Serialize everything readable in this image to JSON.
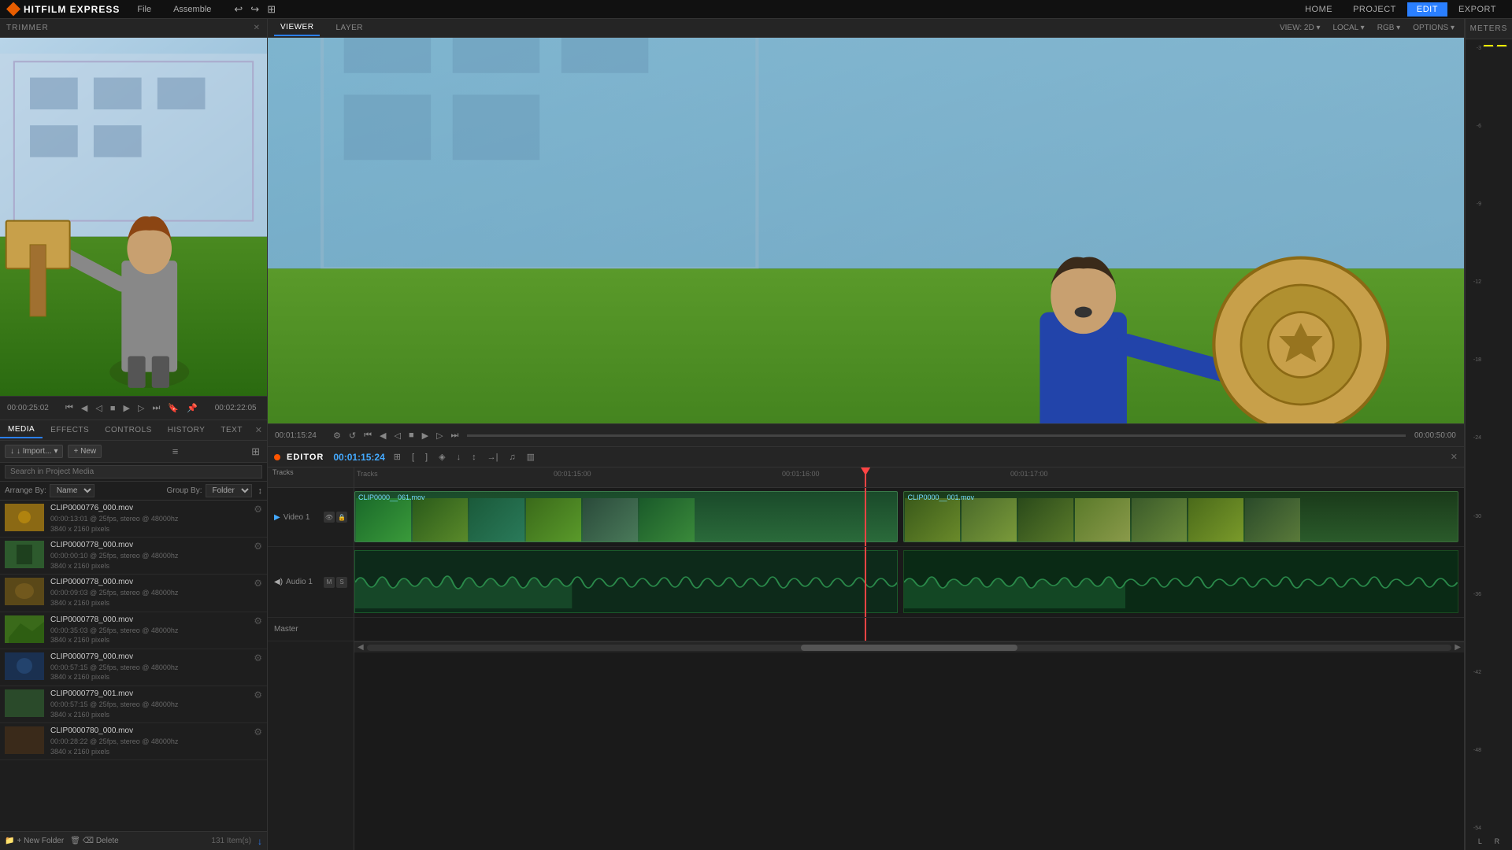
{
  "app": {
    "logo": "HITFILM EXPRESS",
    "nav": {
      "menus": [
        "File",
        "Assemble"
      ],
      "tabs": [
        "HOME",
        "PROJECT",
        "EDIT",
        "EXPORT"
      ],
      "active_tab": "EDIT"
    }
  },
  "trimmer": {
    "label": "TRIMMER",
    "time_start": "00:00:25:02",
    "time_end": "00:02:22:05",
    "controls": [
      "⏮",
      "◀◀",
      "◀",
      "▶",
      "▶▶",
      "⏭"
    ]
  },
  "panels": {
    "tabs": [
      "MEDIA",
      "EFFECTS",
      "CONTROLS",
      "HISTORY",
      "TEXT"
    ],
    "active_tab": "MEDIA"
  },
  "media": {
    "import_btn": "↓ Import...",
    "new_btn": "+ New",
    "search_placeholder": "Search in Project Media",
    "arrange_label": "Arrange By: Name",
    "group_label": "Group By: Folder",
    "items": [
      {
        "name": "CLIP0000776_000.mov",
        "meta1": "3840 x 2160 pixels",
        "meta2": "00:00:13:01 @ 25fps, stereo @ 48000hz"
      },
      {
        "name": "CLIP0000778_000.mov",
        "meta1": "3840 x 2160 pixels",
        "meta2": "00:00:00:10 @ 25fps, stereo @ 48000hz"
      },
      {
        "name": "CLIP0000778_000.mov",
        "meta1": "3840 x 2160 pixels",
        "meta2": "00:00:09:03 @ 25fps, stereo @ 48000hz"
      },
      {
        "name": "CLIP0000778_000.mov",
        "meta1": "3840 x 2160 pixels",
        "meta2": "00:00:35:03 @ 25fps, stereo @ 48000hz"
      },
      {
        "name": "CLIP0000779_000.mov",
        "meta1": "3840 x 2160 pixels",
        "meta2": "00:00:57:15 @ 25fps, stereo @ 48000hz"
      },
      {
        "name": "CLIP0000779_001.mov",
        "meta1": "3840 x 2160 pixels",
        "meta2": "00:00:57:15 @ 25fps, stereo @ 48000hz"
      },
      {
        "name": "CLIP0000780_000.mov",
        "meta1": "3840 x 2160 pixels",
        "meta2": "00:00:28:22 @ 25fps, stereo @ 48000hz"
      }
    ],
    "footer": {
      "new_folder": "+ New Folder",
      "delete": "⌫ Delete",
      "item_count": "131 Item(s)"
    }
  },
  "viewer": {
    "tabs": [
      "VIEWER",
      "LAYER"
    ],
    "active_tab": "VIEWER",
    "options": [
      "VIEW: 2D ▾",
      "LOCAL ▾",
      "RGB ▾",
      "OPTIONS ▾"
    ],
    "time_start": "00:01:15:24",
    "time_end": "00:00:50:00"
  },
  "editor": {
    "label": "EDITOR",
    "timecode": "00:01:15:24",
    "tracks_label": "Tracks",
    "ruler": {
      "marks": [
        "00:01:15:00",
        "00:01:16:00",
        "00:01:17:00"
      ]
    },
    "video_track": {
      "label": "Video 1",
      "clips": [
        {
          "name": "CLIP0000__061.mov",
          "start": 0,
          "width": 49
        },
        {
          "name": "CLIP0000__001.mov",
          "start": 49.5,
          "width": 50
        }
      ]
    },
    "audio_track": {
      "label": "Audio 1"
    },
    "master_track": {
      "label": "Master"
    }
  },
  "meters": {
    "label": "METERS",
    "scale": [
      "-3",
      "-6",
      "-9",
      "-12",
      "-18",
      "-24",
      "-30",
      "-36",
      "-42",
      "-48",
      "-54"
    ],
    "channels": [
      "L",
      "R"
    ]
  }
}
